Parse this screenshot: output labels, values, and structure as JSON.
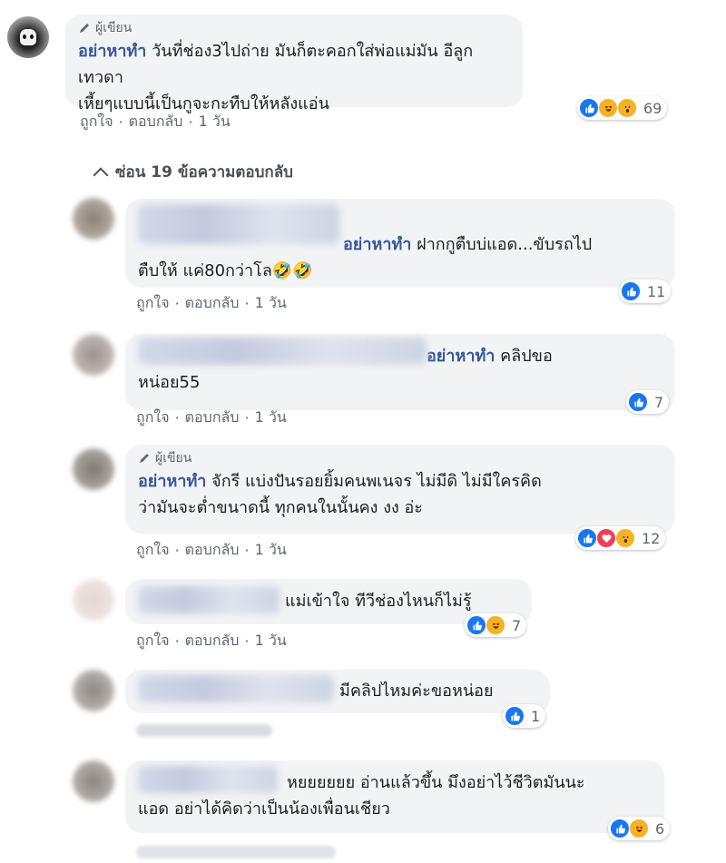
{
  "author_badge": "ผู้เขียน",
  "action_like": "ถูกใจ",
  "action_reply": "ตอบกลับ",
  "separator": "·",
  "time": "1 วัน",
  "top_comment": {
    "name": "อย่าหาทำ",
    "text_line1": "วันที่ช่อง3ไปถ่าย มันก็ตะคอกใส่พ่อแม่มัน อีลูกเทวดา",
    "text_line2": "เหี้ยๆแบบนี้เป็นกูจะกะทืบให้หลังแอ่น",
    "reactions": [
      "like",
      "haha",
      "wow"
    ],
    "reaction_count": "69"
  },
  "toggle_replies": "ซ่อน 19 ข้อความตอบกลับ",
  "replies": [
    {
      "mention": "อย่าหาทำ",
      "text_line1": "ฝากกูตืบบ่แอด...ขับรถไป",
      "text_line2": "ตืบให้ แค่80กว่าโล🤣🤣",
      "reactions": [
        "like"
      ],
      "reaction_count": "11"
    },
    {
      "mention": "อย่าหาทำ",
      "text_line1": "คลิปขอ",
      "text_line2": "หน่อย55",
      "reactions": [
        "like"
      ],
      "reaction_count": "7"
    },
    {
      "name": "อย่าหาทำ",
      "text_line1": "จักรี แบ่งปันรอยยิ้มคนพเนจร ไม่มีดิ ไม่มีใครคิด",
      "text_line2": "ว่ามันจะต่ำขนาดนี้ ทุกคนในนั้นคง งง อ่ะ",
      "reactions": [
        "like",
        "love",
        "wow"
      ],
      "reaction_count": "12"
    },
    {
      "text_line1": "แม่เข้าใจ ทีวีช่องไหนก็ไม่รู้",
      "reactions": [
        "like",
        "haha"
      ],
      "reaction_count": "7"
    },
    {
      "text_line1": "มีคลิปไหมค่ะขอหน่อย",
      "reactions": [
        "like"
      ],
      "reaction_count": "1"
    },
    {
      "text_line1": "หยยยยยย อ่านแล้วขึ้น มึงอย่าไว้ชีวิตมันนะ",
      "text_line2": "แอด อย่าได้คิดว่าเป็นน้องเพื่อนเชียว",
      "reactions": [
        "like",
        "haha"
      ],
      "reaction_count": "6"
    }
  ],
  "colors": {
    "name_blue": "#385898",
    "bubble_gray": "#f2f3f5",
    "meta_gray": "#606770",
    "like_blue": "#1877f2",
    "haha_yellow": "#f7b125",
    "love_red": "#f33e58"
  }
}
